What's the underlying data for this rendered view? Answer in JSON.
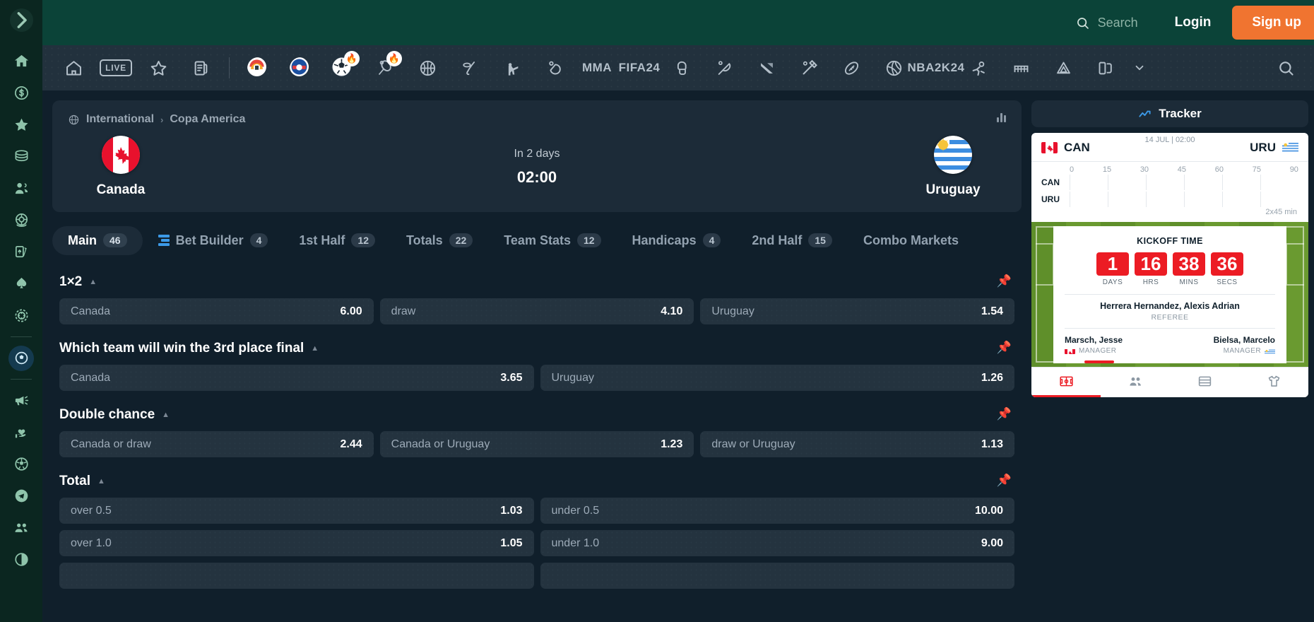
{
  "topbar": {
    "search_placeholder": "Search",
    "login_label": "Login",
    "signup_label": "Sign up",
    "search_icon": "search-icon"
  },
  "sidebar": {
    "toggle_icon": "chevron-right-icon",
    "items": [
      {
        "icon": "home-icon",
        "name": "home"
      },
      {
        "icon": "dollar-coin-icon",
        "name": "bonuses"
      },
      {
        "icon": "star-icon",
        "name": "favorites"
      },
      {
        "icon": "coins-stack-icon",
        "name": "jackpot"
      },
      {
        "icon": "users-icon",
        "name": "referral"
      },
      {
        "icon": "roulette-icon",
        "name": "live-casino"
      },
      {
        "icon": "playing-cards-icon",
        "name": "table-games"
      },
      {
        "icon": "spade-icon",
        "name": "poker"
      },
      {
        "icon": "casino-chip-icon",
        "name": "casino"
      },
      {
        "icon": "soccer-shield-icon",
        "name": "sports"
      },
      {
        "icon": "megaphone-icon",
        "name": "promotions"
      },
      {
        "icon": "heart-hand-icon",
        "name": "responsible-gaming"
      },
      {
        "icon": "soccer-ball-icon",
        "name": "virtual-sports"
      },
      {
        "icon": "telegram-icon",
        "name": "telegram"
      },
      {
        "icon": "community-icon",
        "name": "community"
      },
      {
        "icon": "dark-mode-icon",
        "name": "theme-toggle"
      }
    ]
  },
  "sportsnav": {
    "items": [
      {
        "icon": "home-icon",
        "label": ""
      },
      {
        "icon": "live-badge-icon",
        "label": "LIVE"
      },
      {
        "icon": "star-icon",
        "label": ""
      },
      {
        "icon": "bet-slip-icon",
        "label": ""
      },
      {
        "icon": "team-crest-icon",
        "label": ""
      },
      {
        "icon": "team-crest-2-icon",
        "label": ""
      },
      {
        "icon": "soccer-hot-icon",
        "label": ""
      },
      {
        "icon": "tennis-hot-icon",
        "label": ""
      },
      {
        "icon": "basketball-icon",
        "label": ""
      },
      {
        "icon": "ice-hockey-icon",
        "label": ""
      },
      {
        "icon": "shooting-icon",
        "label": ""
      },
      {
        "icon": "table-tennis-icon",
        "label": ""
      },
      {
        "icon": "mma-icon",
        "label": "MMA"
      },
      {
        "icon": "fifa-24-icon",
        "label": "FIFA24"
      },
      {
        "icon": "boxing-icon",
        "label": ""
      },
      {
        "icon": "badminton-icon",
        "label": ""
      },
      {
        "icon": "esports-icon",
        "label": ""
      },
      {
        "icon": "cricket-icon",
        "label": ""
      },
      {
        "icon": "american-football-icon",
        "label": ""
      },
      {
        "icon": "volleyball-icon",
        "label": ""
      },
      {
        "icon": "nba-2k-icon",
        "label": "NBA2K24"
      },
      {
        "icon": "handball-icon",
        "label": ""
      },
      {
        "icon": "futsal-icon",
        "label": ""
      },
      {
        "icon": "darts-icon",
        "label": ""
      },
      {
        "icon": "snooker-icon",
        "label": ""
      }
    ],
    "more_icon": "chevron-down-icon",
    "search_icon": "search-icon"
  },
  "match": {
    "breadcrumb_icon": "globe-icon",
    "category": "International",
    "separator": "›",
    "league": "Copa America",
    "stats_icon": "bar-chart-icon",
    "home": {
      "name": "Canada",
      "flag": "canada-flag"
    },
    "away": {
      "name": "Uruguay",
      "flag": "uruguay-flag"
    },
    "when": "In 2 days",
    "time": "02:00"
  },
  "tabs": [
    {
      "label": "Main",
      "count": "46",
      "active": true,
      "icon": ""
    },
    {
      "label": "Bet Builder",
      "count": "4",
      "active": false,
      "icon": "bet-builder-icon"
    },
    {
      "label": "1st Half",
      "count": "12",
      "active": false,
      "icon": ""
    },
    {
      "label": "Totals",
      "count": "22",
      "active": false,
      "icon": ""
    },
    {
      "label": "Team Stats",
      "count": "12",
      "active": false,
      "icon": ""
    },
    {
      "label": "Handicaps",
      "count": "4",
      "active": false,
      "icon": ""
    },
    {
      "label": "2nd Half",
      "count": "15",
      "active": false,
      "icon": ""
    },
    {
      "label": "Combo Markets",
      "count": "",
      "active": false,
      "icon": ""
    }
  ],
  "markets": [
    {
      "title": "1×2",
      "caret_icon": "caret-up-icon",
      "pin_icon": "pin-icon",
      "rows": [
        [
          {
            "label": "Canada",
            "odds": "6.00"
          },
          {
            "label": "draw",
            "odds": "4.10"
          },
          {
            "label": "Uruguay",
            "odds": "1.54"
          }
        ]
      ]
    },
    {
      "title": "Which team will win the 3rd place final",
      "caret_icon": "caret-up-icon",
      "pin_icon": "pin-icon",
      "rows": [
        [
          {
            "label": "Canada",
            "odds": "3.65"
          },
          {
            "label": "Uruguay",
            "odds": "1.26"
          }
        ]
      ]
    },
    {
      "title": "Double chance",
      "caret_icon": "caret-up-icon",
      "pin_icon": "pin-icon",
      "rows": [
        [
          {
            "label": "Canada or draw",
            "odds": "2.44"
          },
          {
            "label": "Canada or Uruguay",
            "odds": "1.23"
          },
          {
            "label": "draw or Uruguay",
            "odds": "1.13"
          }
        ]
      ]
    },
    {
      "title": "Total",
      "caret_icon": "caret-up-icon",
      "pin_icon": "pin-icon",
      "rows": [
        [
          {
            "label": "over 0.5",
            "odds": "1.03"
          },
          {
            "label": "under 0.5",
            "odds": "10.00"
          }
        ],
        [
          {
            "label": "over 1.0",
            "odds": "1.05"
          },
          {
            "label": "under 1.0",
            "odds": "9.00"
          }
        ]
      ]
    }
  ],
  "tracker": {
    "title": "Tracker",
    "title_icon": "trending-icon",
    "date": "14 JUL | 02:00",
    "home_code": "CAN",
    "away_code": "URU",
    "home_flag": "canada-flag",
    "away_flag": "uruguay-flag",
    "ticks": [
      "0",
      "15",
      "30",
      "45",
      "60",
      "75",
      "90"
    ],
    "row_codes": [
      "CAN",
      "URU"
    ],
    "duration_note": "2x45 min",
    "kickoff_title": "KICKOFF TIME",
    "countdown": [
      {
        "value": "1",
        "label": "DAYS"
      },
      {
        "value": "16",
        "label": "HRS"
      },
      {
        "value": "38",
        "label": "MINS"
      },
      {
        "value": "36",
        "label": "SECS"
      }
    ],
    "referee_name": "Herrera Hernandez, Alexis Adrian",
    "referee_label": "REFEREE",
    "home_manager": {
      "name": "Marsch, Jesse",
      "label": "MANAGER",
      "flag": "canada-flag"
    },
    "away_manager": {
      "name": "Bielsa, Marcelo",
      "label": "MANAGER",
      "flag": "uruguay-flag"
    },
    "panel_tabs": [
      {
        "icon": "pitch-icon",
        "active": true
      },
      {
        "icon": "lineup-icon",
        "active": false
      },
      {
        "icon": "table-icon",
        "active": false
      },
      {
        "icon": "jersey-icon",
        "active": false
      }
    ]
  },
  "colors": {
    "brand_green": "#0b4338",
    "sidebar_green": "#0b2620",
    "accent_orange": "#f07430",
    "accent_blue": "#3c9ae8",
    "red": "#ec1c24",
    "card_bg": "#1c2b38",
    "page_bg": "#101f2b"
  }
}
